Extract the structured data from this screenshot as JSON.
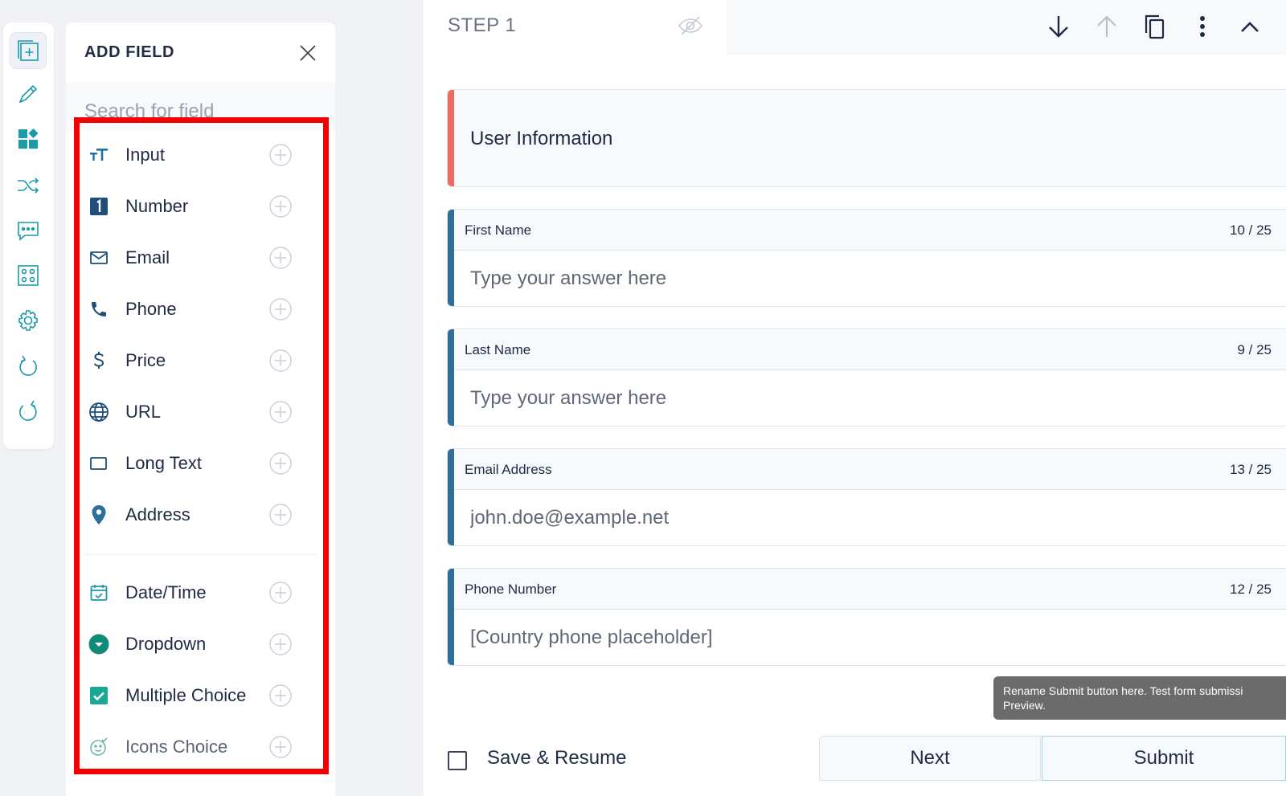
{
  "panel": {
    "title": "ADD FIELD",
    "search_placeholder": "Search for field",
    "fields": [
      {
        "label": "Input",
        "icon": "text-type-icon"
      },
      {
        "label": "Number",
        "icon": "number-icon"
      },
      {
        "label": "Email",
        "icon": "envelope-icon"
      },
      {
        "label": "Phone",
        "icon": "phone-icon"
      },
      {
        "label": "Price",
        "icon": "dollar-icon"
      },
      {
        "label": "URL",
        "icon": "globe-icon"
      },
      {
        "label": "Long Text",
        "icon": "textarea-icon"
      },
      {
        "label": "Address",
        "icon": "map-pin-icon"
      },
      {
        "label": "Date/Time",
        "icon": "calendar-icon"
      },
      {
        "label": "Dropdown",
        "icon": "dropdown-icon"
      },
      {
        "label": "Multiple Choice",
        "icon": "checkbox-icon"
      },
      {
        "label": "Icons Choice",
        "icon": "smiley-icon"
      }
    ]
  },
  "rail": {
    "items": [
      "add-field-icon",
      "pen-icon",
      "widgets-icon",
      "shuffle-icon",
      "chat-icon",
      "grid-icon",
      "gear-icon",
      "undo-icon",
      "redo-icon"
    ]
  },
  "step": {
    "label": "STEP 1"
  },
  "form": {
    "section_title": "User Information",
    "questions": [
      {
        "label": "First Name",
        "count": "10 / 25",
        "placeholder": "Type your answer here",
        "value": ""
      },
      {
        "label": "Last Name",
        "count": "9 / 25",
        "placeholder": "Type your answer here",
        "value": ""
      },
      {
        "label": "Email Address",
        "count": "13 / 25",
        "placeholder": "john.doe@example.net",
        "value": ""
      },
      {
        "label": "Phone Number",
        "count": "12 / 25",
        "placeholder": "[Country phone placeholder]",
        "value": ""
      }
    ]
  },
  "tooltip": {
    "line1": "Rename Submit button here. Test form submissi",
    "line2": "Preview."
  },
  "footer": {
    "save_label": "Save & Resume",
    "next_label": "Next",
    "submit_label": "Submit"
  },
  "colors": {
    "accent_teal": "#1b9aaa",
    "question_accent": "#2e6e98",
    "section_accent": "#ee6b62",
    "highlight": "#f50000"
  }
}
